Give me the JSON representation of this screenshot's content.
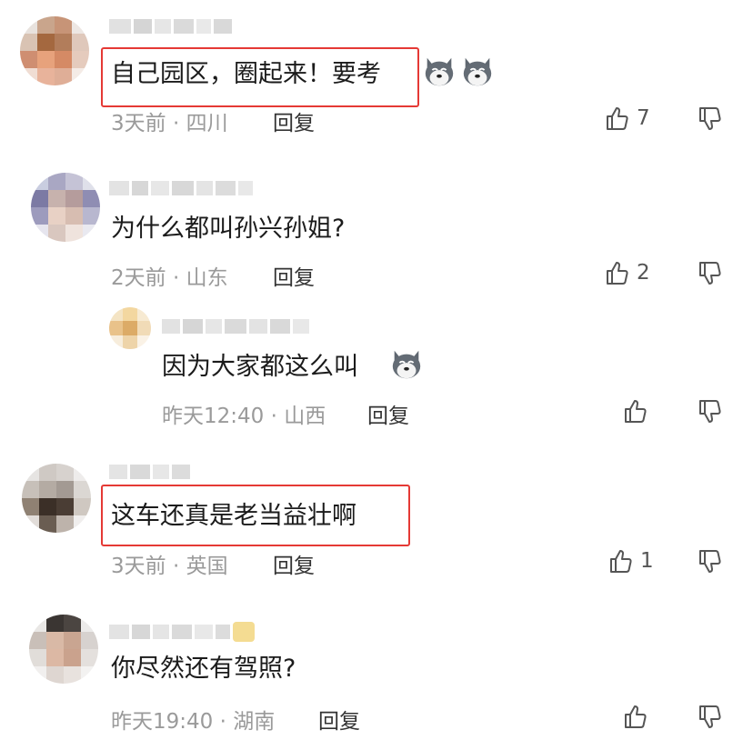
{
  "comments": [
    {
      "text": "自己园区，圈起来！要考",
      "emoji_count": 2,
      "emoji_icon": "husky-face-icon",
      "meta": "3天前 · 四川",
      "reply": "回复",
      "likes": "7",
      "highlighted": true
    },
    {
      "text": "为什么都叫孙兴孙姐?",
      "meta": "2天前 · 山东",
      "reply": "回复",
      "likes": "2",
      "sub_reply": {
        "text": "因为大家都这么叫",
        "emoji_count": 1,
        "emoji_icon": "husky-face-icon",
        "meta": "昨天12:40 · 山西",
        "reply": "回复",
        "likes": ""
      }
    },
    {
      "text": "这车还真是老当益壮啊",
      "meta": "3天前 · 英国",
      "reply": "回复",
      "likes": "1",
      "highlighted": true
    },
    {
      "text": "你尽然还有驾照?",
      "meta": "昨天19:40 · 湖南",
      "reply": "回复",
      "likes": ""
    }
  ],
  "colors": {
    "highlight_border": "#e53935",
    "meta_text": "#9a9a9a"
  },
  "icons": {
    "like": "thumbs-up-icon",
    "dislike": "thumbs-down-icon"
  }
}
